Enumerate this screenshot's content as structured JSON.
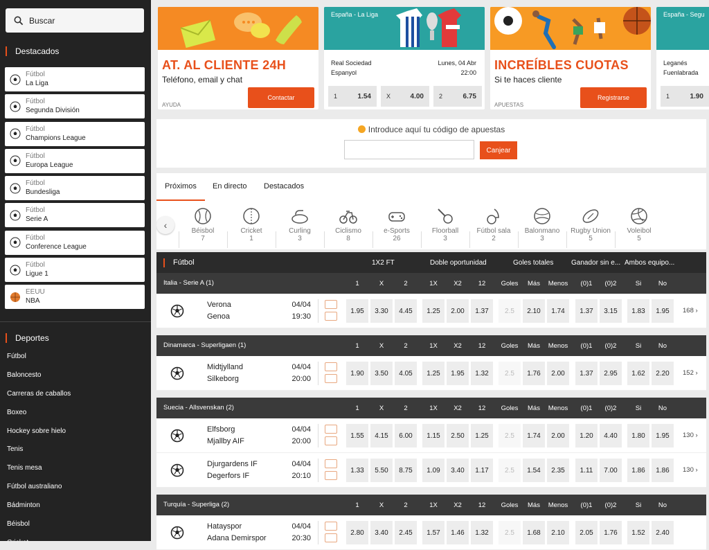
{
  "sidebar": {
    "search_label": "Buscar",
    "featured_title": "Destacados",
    "featured": [
      {
        "sport": "Fútbol",
        "league": "La Liga",
        "icon": "soccer-ball"
      },
      {
        "sport": "Fútbol",
        "league": "Segunda División",
        "icon": "soccer-ball"
      },
      {
        "sport": "Fútbol",
        "league": "Champions League",
        "icon": "soccer-ball"
      },
      {
        "sport": "Fútbol",
        "league": "Europa League",
        "icon": "soccer-ball"
      },
      {
        "sport": "Fútbol",
        "league": "Bundesliga",
        "icon": "soccer-ball"
      },
      {
        "sport": "Fútbol",
        "league": "Serie A",
        "icon": "soccer-ball"
      },
      {
        "sport": "Fútbol",
        "league": "Conference League",
        "icon": "soccer-ball"
      },
      {
        "sport": "Fútbol",
        "league": "Ligue 1",
        "icon": "soccer-ball"
      },
      {
        "sport": "EEUU",
        "league": "NBA",
        "icon": "basketball"
      }
    ],
    "sports_title": "Deportes",
    "sports": [
      "Fútbol",
      "Baloncesto",
      "Carreras de caballos",
      "Boxeo",
      "Hockey sobre hielo",
      "Tenis",
      "Tenis mesa",
      "Fútbol australiano",
      "Bádminton",
      "Béisbol",
      "Cricket"
    ]
  },
  "banners": {
    "support": {
      "title": "AT. AL CLIENTE 24H",
      "subtitle": "Teléfono, email y chat",
      "category": "AYUDA",
      "button": "Contactar"
    },
    "match1": {
      "league": "España - La Liga",
      "home": "Real Sociedad",
      "away": "Espanyol",
      "date": "Lunes, 04 Abr",
      "time": "22:00",
      "odds": [
        {
          "k": "1",
          "v": "1.54"
        },
        {
          "k": "X",
          "v": "4.00"
        },
        {
          "k": "2",
          "v": "6.75"
        }
      ]
    },
    "promo": {
      "title": "INCREÍBLES CUOTAS",
      "subtitle": "Si te haces cliente",
      "category": "APUESTAS",
      "button": "Registrarse"
    },
    "match2": {
      "league": "España - Segu",
      "home": "Leganés",
      "away": "Fuenlabrada",
      "odds": [
        {
          "k": "1",
          "v": "1.90"
        }
      ]
    }
  },
  "code": {
    "label": "Introduce aquí tu código de apuestas",
    "button": "Canjear"
  },
  "tabs": [
    "Próximos",
    "En directo",
    "Destacados"
  ],
  "categories": [
    {
      "name": "Béisbol",
      "count": "7",
      "icon": "baseball-icon"
    },
    {
      "name": "Cricket",
      "count": "1",
      "icon": "cricket-ball-icon"
    },
    {
      "name": "Curling",
      "count": "3",
      "icon": "curling-stone-icon"
    },
    {
      "name": "Ciclismo",
      "count": "8",
      "icon": "bicycle-icon"
    },
    {
      "name": "e-Sports",
      "count": "26",
      "icon": "gamepad-icon"
    },
    {
      "name": "Floorball",
      "count": "3",
      "icon": "floorball-icon"
    },
    {
      "name": "Fútbol sala",
      "count": "2",
      "icon": "futsal-icon"
    },
    {
      "name": "Balonmano",
      "count": "3",
      "icon": "handball-icon"
    },
    {
      "name": "Rugby Union",
      "count": "5",
      "icon": "rugby-ball-icon"
    },
    {
      "name": "Voleibol",
      "count": "5",
      "icon": "volleyball-icon"
    }
  ],
  "board": {
    "sport": "Fútbol",
    "groups": [
      "1X2 FT",
      "Doble oportunidad",
      "Goles totales",
      "Ganador sin e...",
      "Ambos equipo..."
    ],
    "cols": [
      "1",
      "X",
      "2",
      "1X",
      "X2",
      "12",
      "Goles",
      "Más",
      "Menos",
      "(0)1",
      "(0)2",
      "Si",
      "No"
    ],
    "leagues": [
      {
        "name": "Italia - Serie A (1)",
        "matches": [
          {
            "home": "Verona",
            "away": "Genoa",
            "date": "04/04",
            "time": "19:30",
            "odds": [
              "1.95",
              "3.30",
              "4.45",
              "1.25",
              "2.00",
              "1.37",
              "2.5",
              "2.10",
              "1.74",
              "1.37",
              "3.15",
              "1.83",
              "1.95"
            ],
            "more": "168 ›"
          }
        ]
      },
      {
        "name": "Dinamarca - Superligaen (1)",
        "matches": [
          {
            "home": "Midtjylland",
            "away": "Silkeborg",
            "date": "04/04",
            "time": "20:00",
            "odds": [
              "1.90",
              "3.50",
              "4.05",
              "1.25",
              "1.95",
              "1.32",
              "2.5",
              "1.76",
              "2.00",
              "1.37",
              "2.95",
              "1.62",
              "2.20"
            ],
            "more": "152 ›"
          }
        ]
      },
      {
        "name": "Suecia - Allsvenskan (2)",
        "matches": [
          {
            "home": "Elfsborg",
            "away": "Mjallby AIF",
            "date": "04/04",
            "time": "20:00",
            "odds": [
              "1.55",
              "4.15",
              "6.00",
              "1.15",
              "2.50",
              "1.25",
              "2.5",
              "1.74",
              "2.00",
              "1.20",
              "4.40",
              "1.80",
              "1.95"
            ],
            "more": "130 ›"
          },
          {
            "home": "Djurgardens IF",
            "away": "Degerfors IF",
            "date": "04/04",
            "time": "20:10",
            "odds": [
              "1.33",
              "5.50",
              "8.75",
              "1.09",
              "3.40",
              "1.17",
              "2.5",
              "1.54",
              "2.35",
              "1.11",
              "7.00",
              "1.86",
              "1.86"
            ],
            "more": "130 ›"
          }
        ]
      },
      {
        "name": "Turquía - Superliga (2)",
        "matches": [
          {
            "home": "Hatayspor",
            "away": "Adana Demirspor",
            "date": "04/04",
            "time": "20:30",
            "odds": [
              "2.80",
              "3.40",
              "2.45",
              "1.57",
              "1.46",
              "1.32",
              "2.5",
              "1.68",
              "2.10",
              "2.05",
              "1.76",
              "1.52",
              "2.40"
            ],
            "more": ""
          }
        ]
      }
    ]
  },
  "colors": {
    "accent": "#e8501b",
    "dark": "#232323"
  }
}
